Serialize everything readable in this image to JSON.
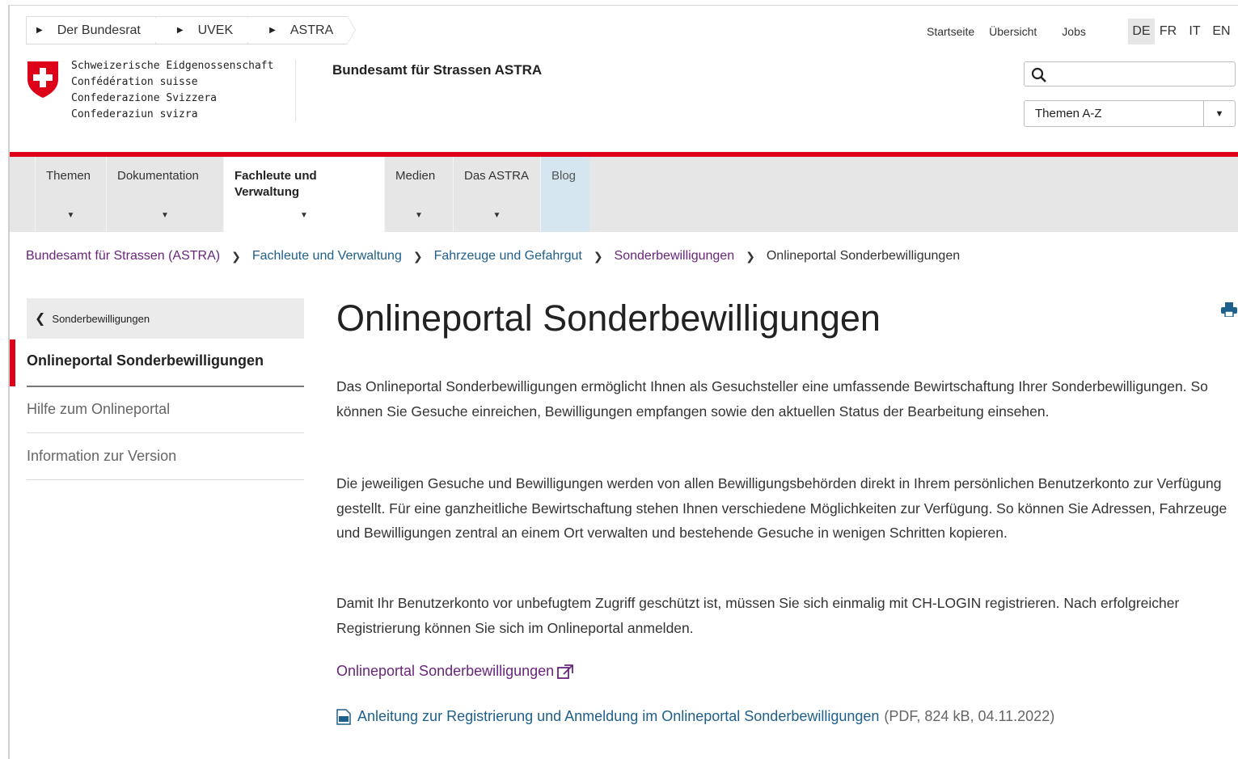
{
  "top_breadcrumb": [
    "Der Bundesrat",
    "UVEK",
    "ASTRA"
  ],
  "top_links": [
    "Startseite",
    "Übersicht",
    "Jobs"
  ],
  "languages": [
    "DE",
    "FR",
    "IT",
    "EN"
  ],
  "active_language": "DE",
  "logo_lines": [
    "Schweizerische Eidgenossenschaft",
    "Confédération suisse",
    "Confederazione Svizzera",
    "Confederaziun svizra"
  ],
  "agency_name": "Bundesamt für Strassen ASTRA",
  "search": {
    "value": ""
  },
  "topics_select": {
    "selected": "Themen A-Z"
  },
  "nav": {
    "themen": "Themen",
    "dokumentation": "Dokumentation",
    "fachleute_1": "Fachleute und",
    "fachleute_2": "Verwaltung",
    "medien": "Medien",
    "astra": "Das ASTRA",
    "blog": "Blog"
  },
  "breadcrumb": [
    "Bundesamt für Strassen (ASTRA)",
    "Fachleute und Verwaltung",
    "Fahrzeuge und Gefahrgut",
    "Sonderbewilligungen",
    "Onlineportal Sonderbewilligungen"
  ],
  "sidebar": {
    "back_label": "Sonderbewilligungen",
    "active": "Onlineportal Sonderbewilligungen",
    "items": [
      "Hilfe zum Onlineportal",
      "Information zur Version"
    ]
  },
  "main": {
    "title": "Onlineportal Sonderbewilligungen",
    "p1": "Das Onlineportal Sonderbewilligungen ermöglicht Ihnen als Gesuchsteller eine umfassende Bewirtschaftung Ihrer Sonderbewilligungen. So können Sie Gesuche einreichen, Bewilligungen empfangen sowie den aktuellen Status der Bearbeitung einsehen.",
    "p2": "Die jeweiligen Gesuche und Bewilligungen werden von allen Bewilligungsbehörden direkt in Ihrem persönlichen Benutzerkonto zur Verfügung gestellt. Für eine ganzheitliche Bewirtschaftung stehen Ihnen verschiedene Möglichkeiten zur Verfügung. So können Sie Adressen, Fahrzeuge und Bewilligungen zentral an einem Ort verwalten und bestehende Gesuche in wenigen Schritten kopieren.",
    "p3": "Damit Ihr Benutzerkonto vor unbefugtem Zugriff geschützt ist, müssen Sie sich einmalig mit CH-LOGIN registrieren. Nach erfolgreicher Registrierung können Sie sich im Onlineportal anmelden.",
    "external_link": "Onlineportal Sonderbewilligungen",
    "pdf_link": "Anleitung zur Registrierung und Anmeldung im Onlineportal Sonderbewilligungen",
    "pdf_meta": "(PDF, 824 kB, 04.11.2022)"
  },
  "colors": {
    "swiss_red": "#dc0018",
    "link_purple": "#69257c",
    "link_blue": "#1f5f8b"
  }
}
